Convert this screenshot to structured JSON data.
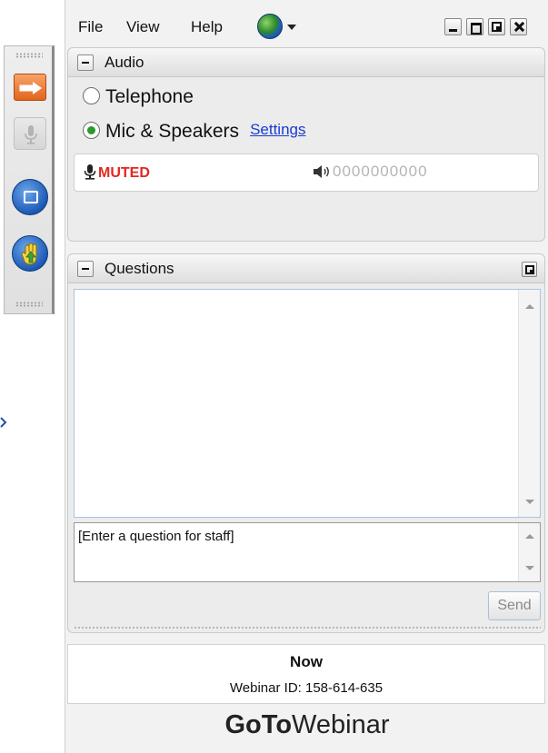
{
  "menu": {
    "file": "File",
    "view": "View",
    "help": "Help"
  },
  "audio": {
    "title": "Audio",
    "options": [
      {
        "label": "Telephone",
        "selected": false
      },
      {
        "label": "Mic & Speakers",
        "selected": true
      }
    ],
    "settings_link": "Settings",
    "mic_status": "MUTED",
    "speaker_level": "0000000000",
    "colors": {
      "muted": "#e3261f",
      "selected_radio": "#2a9a2a",
      "link": "#1a3bd1"
    }
  },
  "questions": {
    "title": "Questions",
    "input_text": "[Enter a question for staff]",
    "send_label": "Send"
  },
  "session": {
    "name": "Now",
    "webinar_id": "Webinar ID: 158-614-635"
  },
  "brand": {
    "part1": "GoTo",
    "part2": "Webinar"
  },
  "toolbar": {
    "icons": [
      "arrow-icon",
      "microphone-icon",
      "screen-icon",
      "raise-hand-icon"
    ]
  }
}
